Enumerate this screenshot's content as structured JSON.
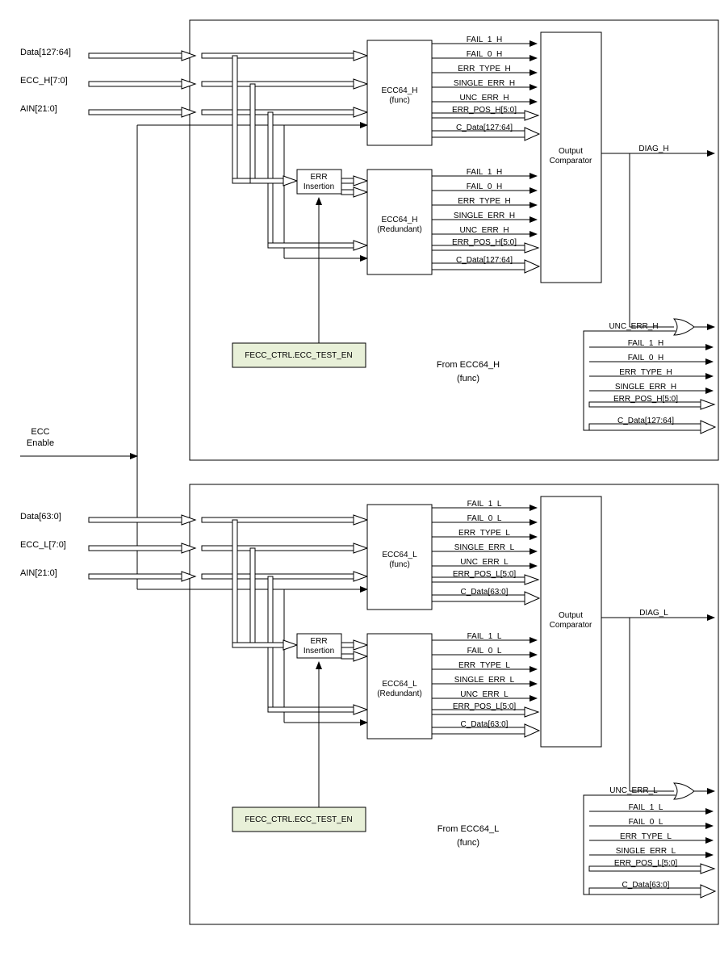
{
  "inputs_h": {
    "data": "Data[127:64]",
    "ecc": "ECC_H[7:0]",
    "ain": "AIN[21:0]"
  },
  "inputs_l": {
    "data": "Data[63:0]",
    "ecc": "ECC_L[7:0]",
    "ain": "AIN[21:0]"
  },
  "ecc_enable": "ECC\nEnable",
  "ecc_enable_line1": "ECC",
  "ecc_enable_line2": "Enable",
  "blocks_h": {
    "func": "ECC64_H",
    "func_sub": "(func)",
    "redundant": "ECC64_H",
    "redundant_sub": "(Redundant)",
    "err_insertion": "ERR",
    "err_insertion2": "Insertion",
    "comparator": "Output",
    "comparator2": "Comparator",
    "register": "FECC_CTRL.ECC_TEST_EN",
    "from_label1": "From ECC64_H",
    "from_label2": "(func)"
  },
  "blocks_l": {
    "func": "ECC64_L",
    "func_sub": "(func)",
    "redundant": "ECC64_L",
    "redundant_sub": "(Redundant)",
    "err_insertion": "ERR",
    "err_insertion2": "Insertion",
    "comparator": "Output",
    "comparator2": "Comparator",
    "register": "FECC_CTRL.ECC_TEST_EN",
    "from_label1": "From ECC64_L",
    "from_label2": "(func)"
  },
  "signals_h": {
    "fail1": "FAIL_1_H",
    "fail0": "FAIL_0_H",
    "err_type": "ERR_TYPE_H",
    "single_err": "SINGLE_ERR_H",
    "unc_err": "UNC_ERR_H",
    "err_pos": "ERR_POS_H[5:0]",
    "c_data": "C_Data[127:64]",
    "diag": "DIAG_H"
  },
  "signals_l": {
    "fail1": "FAIL_1_L",
    "fail0": "FAIL_0_L",
    "err_type": "ERR_TYPE_L",
    "single_err": "SINGLE_ERR_L",
    "unc_err": "UNC_ERR_L",
    "err_pos": "ERR_POS_L[5:0]",
    "c_data": "C_Data[63:0]",
    "diag": "DIAG_L"
  }
}
